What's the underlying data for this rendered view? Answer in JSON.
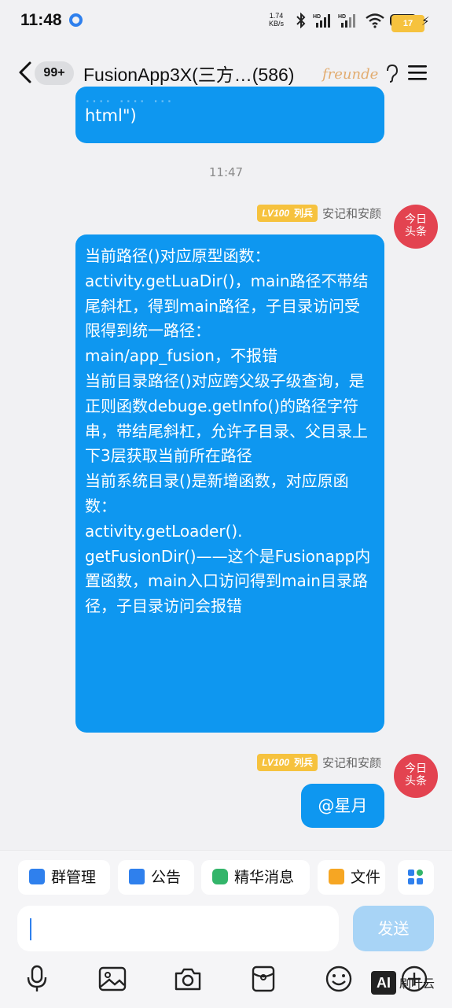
{
  "status": {
    "time": "11:48",
    "netspeed_value": "1.74",
    "netspeed_unit": "KB/s",
    "battery": "17"
  },
  "header": {
    "badge": "99+",
    "title": "FusionApp3X(三方…(586)",
    "brand": "freunde"
  },
  "chat": {
    "top_bubble_text": "html\")",
    "time": "11:47",
    "sender_level": "LV100",
    "sender_rank": "列兵",
    "sender_name": "安记和安颜",
    "avatar_text": "今日\n头条",
    "main_message": "当前路径()对应原型函数：\nactivity.getLuaDir()，main路径不带结尾斜杠，得到main路径，子目录访问受限得到统一路径：\nmain/app_fusion，不报错\n当前目录路径()对应跨父级子级查询，是正则函数debuge.getInfo()的路径字符串，带结尾斜杠，允许子目录、父目录上下3层获取当前所在路径\n当前系统目录()是新增函数，对应原函数：\nactivity.getLoader().\ngetFusionDir()——这个是Fusionapp内置函数，main入口访问得到main目录路径，子目录访问会报错",
    "second_message": "@星月"
  },
  "quick_actions": [
    "群管理",
    "公告",
    "精华消息",
    "文件"
  ],
  "input": {
    "placeholder": "",
    "send_label": "发送"
  },
  "watermark": {
    "ai": "AI",
    "text": "刷叶云"
  }
}
